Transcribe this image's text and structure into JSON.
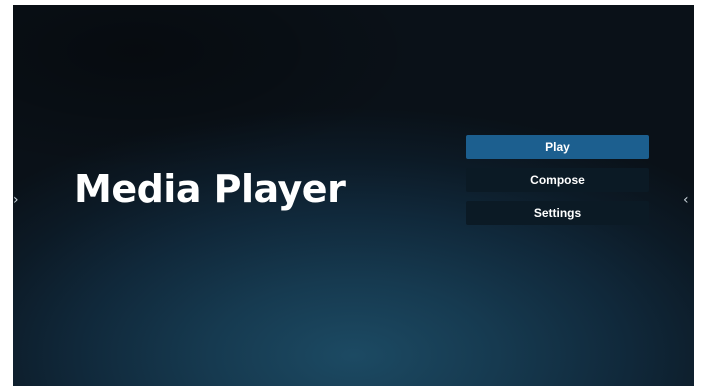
{
  "app": {
    "title": "Media Player"
  },
  "menu": {
    "items": [
      {
        "label": "Play",
        "selected": true
      },
      {
        "label": "Compose",
        "selected": false
      },
      {
        "label": "Settings",
        "selected": false
      }
    ]
  },
  "nav": {
    "left_arrow_glyph": "›",
    "right_arrow_glyph": "‹",
    "left_icon": "chevron-right-icon",
    "right_icon": "chevron-left-icon"
  },
  "colors": {
    "selected_button": "#1c5f8f",
    "button": "#0b1a25",
    "text": "#ffffff"
  }
}
